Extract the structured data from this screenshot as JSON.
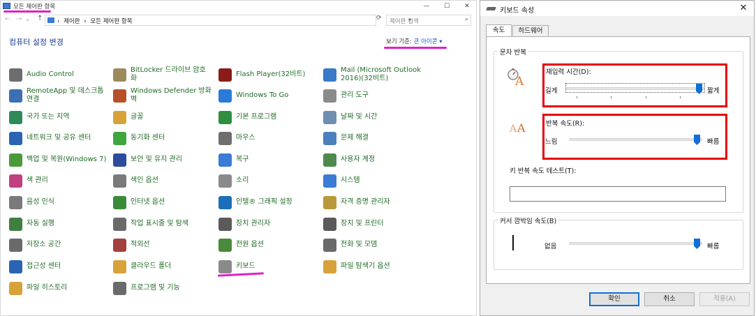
{
  "control_panel": {
    "title": "모든 제어판 항목",
    "window_buttons": {
      "minimize": "—",
      "maximize": "☐",
      "close": "✕"
    },
    "address": {
      "crumbs": [
        "제어판",
        "›",
        "모든 제어판 항목"
      ],
      "separator": "›",
      "search_placeholder": "제어판 검색"
    },
    "heading": "컴퓨터 설정 변경",
    "view_by": {
      "label": "보기 기준:",
      "value": "큰 아이콘 ▾"
    },
    "items": [
      {
        "label": "Audio Control",
        "icon": "audio-icon",
        "color": "#6d6d6d"
      },
      {
        "label": "BitLocker 드라이브 암호\n화",
        "icon": "bitlocker-icon",
        "color": "#9b8a5a"
      },
      {
        "label": "Flash Player(32비트)",
        "icon": "flash-icon",
        "color": "#8b1a1a"
      },
      {
        "label": "Mail (Microsoft Outlook\n2016)(32비트)",
        "icon": "mail-icon",
        "color": "#3a78c8"
      },
      {
        "label": "RemoteApp 및 데스크톱\n연결",
        "icon": "remoteapp-icon",
        "color": "#3c6fb4"
      },
      {
        "label": "Windows Defender 방화\n벽",
        "icon": "firewall-icon",
        "color": "#b7502a"
      },
      {
        "label": "Windows To Go",
        "icon": "windowstogo-icon",
        "color": "#2a7bd6"
      },
      {
        "label": "관리 도구",
        "icon": "admin-tools-icon",
        "color": "#8a8a8a"
      },
      {
        "label": "국가 또는 지역",
        "icon": "region-icon",
        "color": "#2e8b57"
      },
      {
        "label": "글꼴",
        "icon": "fonts-icon",
        "color": "#d8a23a"
      },
      {
        "label": "기본 프로그램",
        "icon": "default-programs-icon",
        "color": "#2f8f3f"
      },
      {
        "label": "날짜 및 시간",
        "icon": "datetime-icon",
        "color": "#6f8fb0"
      },
      {
        "label": "네트워크 및 공유 센터",
        "icon": "network-icon",
        "color": "#2a64b3"
      },
      {
        "label": "동기화 센터",
        "icon": "sync-icon",
        "color": "#3fa63f"
      },
      {
        "label": "마우스",
        "icon": "mouse-icon",
        "color": "#6e6e6e"
      },
      {
        "label": "문제 해결",
        "icon": "troubleshoot-icon",
        "color": "#4c7fbf"
      },
      {
        "label": "백업 및 복원(Windows 7)",
        "icon": "backup-icon",
        "color": "#4a9a3a"
      },
      {
        "label": "보안 및 유지 관리",
        "icon": "security-flag-icon",
        "color": "#2b4c9c"
      },
      {
        "label": "복구",
        "icon": "recovery-icon",
        "color": "#3a7bd5"
      },
      {
        "label": "사용자 계정",
        "icon": "user-accounts-icon",
        "color": "#4e8a4e"
      },
      {
        "label": "색 관리",
        "icon": "color-management-icon",
        "color": "#c04080"
      },
      {
        "label": "색인 옵션",
        "icon": "indexing-icon",
        "color": "#7a7a7a"
      },
      {
        "label": "소리",
        "icon": "sound-icon",
        "color": "#8a8a8a"
      },
      {
        "label": "시스템",
        "icon": "system-icon",
        "color": "#3a7bd5"
      },
      {
        "label": "음성 인식",
        "icon": "microphone-icon",
        "color": "#7a7a7a"
      },
      {
        "label": "인터넷 옵션",
        "icon": "internet-icon",
        "color": "#3a8a3a"
      },
      {
        "label": "인텔® 그래픽 설정",
        "icon": "intel-graphics-icon",
        "color": "#1a6fb8"
      },
      {
        "label": "자격 증명 관리자",
        "icon": "credential-icon",
        "color": "#b89a3a"
      },
      {
        "label": "자동 실행",
        "icon": "autoplay-icon",
        "color": "#3f7f3f"
      },
      {
        "label": "작업 표시줄 및 탐색",
        "icon": "taskbar-icon",
        "color": "#6a6a6a"
      },
      {
        "label": "장치 관리자",
        "icon": "device-manager-icon",
        "color": "#5a5a5a"
      },
      {
        "label": "장치 및 프린터",
        "icon": "printer-icon",
        "color": "#5a5a5a"
      },
      {
        "label": "저장소 공간",
        "icon": "storage-icon",
        "color": "#6a6a6a"
      },
      {
        "label": "적외선",
        "icon": "infrared-icon",
        "color": "#a34040"
      },
      {
        "label": "전원 옵션",
        "icon": "power-icon",
        "color": "#4a8a3a"
      },
      {
        "label": "전화 및 모뎀",
        "icon": "phone-modem-icon",
        "color": "#6a6a6a"
      },
      {
        "label": "접근성 센터",
        "icon": "ease-of-access-icon",
        "color": "#2a64b3"
      },
      {
        "label": "클라우드 폴더",
        "icon": "cloud-folder-icon",
        "color": "#d8a23a"
      },
      {
        "label": "키보드",
        "icon": "keyboard-icon",
        "color": "#8a8a8a"
      },
      {
        "label": "파일 탐색기 옵션",
        "icon": "folder-options-icon",
        "color": "#d8a23a"
      },
      {
        "label": "파일 히스토리",
        "icon": "file-history-icon",
        "color": "#d8a23a"
      },
      {
        "label": "프로그램 및 기능",
        "icon": "programs-features-icon",
        "color": "#6a6a6a"
      }
    ]
  },
  "keyboard_dialog": {
    "title": "키보드 속성",
    "close": "✕",
    "tabs": [
      "속도",
      "하드웨어"
    ],
    "char_repeat_group": "문자 반복",
    "repeat_delay": {
      "label": "재입력 시간(D):",
      "left": "길게",
      "right": "짧게",
      "value_fraction": 1.0
    },
    "repeat_rate": {
      "label": "반복 속도(R):",
      "left": "느림",
      "right": "빠름",
      "value_fraction": 1.0
    },
    "test_label": "키 반복 속도 테스트(T):",
    "test_value": "",
    "cursor_group": "커서 깜박임 속도(B)",
    "cursor_blink": {
      "left": "없음",
      "right": "빠름",
      "value_fraction": 1.0
    },
    "buttons": {
      "ok": "확인",
      "cancel": "취소",
      "apply": "적용(A)"
    },
    "icon_letter": "A"
  },
  "accent_colors": {
    "annotation_pink": "#e020c8",
    "annotation_red": "#e8000b",
    "link_green": "#1f6b24",
    "heading_blue": "#1a3e96"
  }
}
